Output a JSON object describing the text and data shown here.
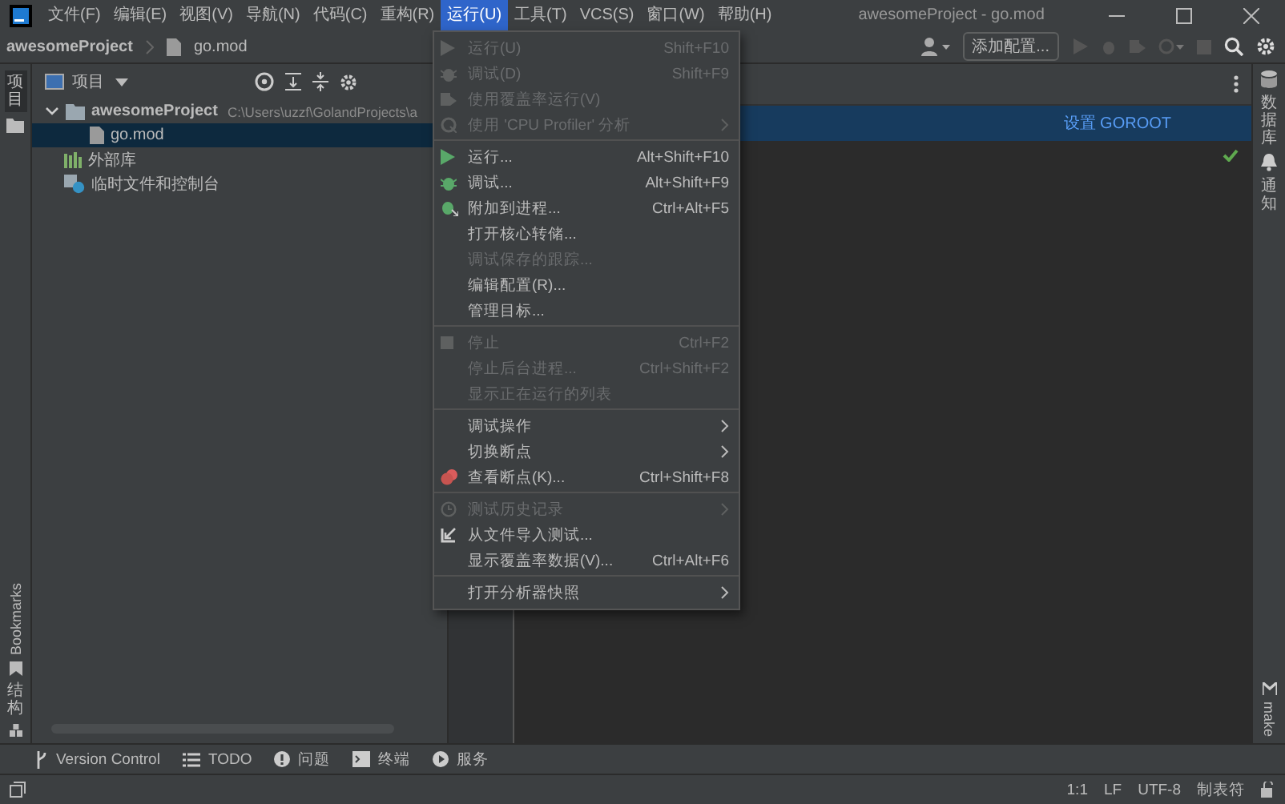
{
  "menu_bar": {
    "items": [
      {
        "label": "文件(F)",
        "selected": false
      },
      {
        "label": "编辑(E)",
        "selected": false
      },
      {
        "label": "视图(V)",
        "selected": false
      },
      {
        "label": "导航(N)",
        "selected": false
      },
      {
        "label": "代码(C)",
        "selected": false
      },
      {
        "label": "重构(R)",
        "selected": false
      },
      {
        "label": "运行(U)",
        "selected": true
      },
      {
        "label": "工具(T)",
        "selected": false
      },
      {
        "label": "VCS(S)",
        "selected": false
      },
      {
        "label": "窗口(W)",
        "selected": false
      },
      {
        "label": "帮助(H)",
        "selected": false
      }
    ]
  },
  "window": {
    "title": "awesomeProject - go.mod"
  },
  "breadcrumb": [
    "awesomeProject",
    "go.mod"
  ],
  "toolbar": {
    "config_button": "添加配置..."
  },
  "left_stripe": {
    "top": "项目",
    "bookmarks": "Bookmarks",
    "structure": "结构"
  },
  "right_stripe": {
    "database": "数据库",
    "notifications": "通知",
    "make": "make"
  },
  "project_panel": {
    "title": "项目",
    "tree": [
      {
        "label": "awesomeProject",
        "path": "C:\\Users\\uzzf\\GolandProjects\\a",
        "kind": "folder",
        "expanded": true,
        "selected": false,
        "children": [
          {
            "label": "go.mod",
            "kind": "file",
            "selected": true
          }
        ]
      },
      {
        "label": "外部库",
        "kind": "library",
        "selected": false
      },
      {
        "label": "临时文件和控制台",
        "kind": "scratch",
        "selected": false
      }
    ]
  },
  "editor": {
    "banner_link": "设置 GOROOT"
  },
  "run_menu": [
    {
      "kind": "item",
      "label": "运行(U)",
      "shortcut": "Shift+F10",
      "enabled": false
    },
    {
      "kind": "item",
      "label": "调试(D)",
      "shortcut": "Shift+F9",
      "enabled": false
    },
    {
      "kind": "item",
      "label": "使用覆盖率运行(V)",
      "enabled": false
    },
    {
      "kind": "submenu",
      "label": "使用 'CPU Profiler' 分析",
      "enabled": false
    },
    {
      "kind": "separator"
    },
    {
      "kind": "item",
      "label": "运行...",
      "shortcut": "Alt+Shift+F10",
      "enabled": true
    },
    {
      "kind": "item",
      "label": "调试...",
      "shortcut": "Alt+Shift+F9",
      "enabled": true
    },
    {
      "kind": "item",
      "label": "附加到进程...",
      "shortcut": "Ctrl+Alt+F5",
      "enabled": true
    },
    {
      "kind": "item",
      "label": "打开核心转储...",
      "enabled": true
    },
    {
      "kind": "item",
      "label": "调试保存的跟踪...",
      "enabled": false
    },
    {
      "kind": "item",
      "label": "编辑配置(R)...",
      "enabled": true
    },
    {
      "kind": "item",
      "label": "管理目标...",
      "enabled": true
    },
    {
      "kind": "separator"
    },
    {
      "kind": "item",
      "label": "停止",
      "shortcut": "Ctrl+F2",
      "enabled": false
    },
    {
      "kind": "item",
      "label": "停止后台进程...",
      "shortcut": "Ctrl+Shift+F2",
      "enabled": false
    },
    {
      "kind": "item",
      "label": "显示正在运行的列表",
      "enabled": false
    },
    {
      "kind": "separator"
    },
    {
      "kind": "submenu",
      "label": "调试操作",
      "enabled": true
    },
    {
      "kind": "submenu",
      "label": "切换断点",
      "enabled": true
    },
    {
      "kind": "item",
      "label": "查看断点(K)...",
      "shortcut": "Ctrl+Shift+F8",
      "enabled": true
    },
    {
      "kind": "separator"
    },
    {
      "kind": "submenu",
      "label": "测试历史记录",
      "enabled": false
    },
    {
      "kind": "item",
      "label": "从文件导入测试...",
      "enabled": true
    },
    {
      "kind": "item",
      "label": "显示覆盖率数据(V)...",
      "shortcut": "Ctrl+Alt+F6",
      "enabled": true
    },
    {
      "kind": "separator"
    },
    {
      "kind": "submenu",
      "label": "打开分析器快照",
      "enabled": true
    }
  ],
  "tool_windows": [
    {
      "label": "Version Control"
    },
    {
      "label": "TODO"
    },
    {
      "label": "问题"
    },
    {
      "label": "终端"
    },
    {
      "label": "服务"
    }
  ],
  "status_bar": {
    "position": "1:1",
    "line_ending": "LF",
    "encoding": "UTF-8",
    "indent": "制表符"
  }
}
